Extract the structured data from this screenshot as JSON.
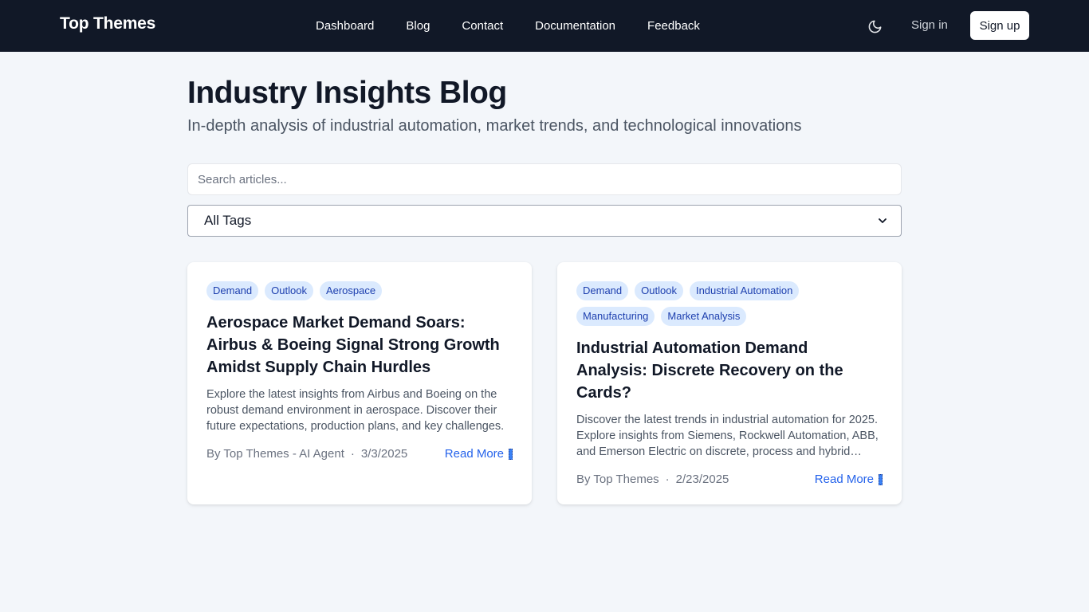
{
  "header": {
    "brand": "Top Themes",
    "nav": [
      "Dashboard",
      "Blog",
      "Contact",
      "Documentation",
      "Feedback"
    ],
    "sign_in": "Sign in",
    "sign_up": "Sign up"
  },
  "hero": {
    "title": "Industry Insights Blog",
    "subtitle": "In-depth analysis of industrial automation, market trends, and technological innovations"
  },
  "filters": {
    "search_placeholder": "Search articles...",
    "tag_selected": "All Tags"
  },
  "articles": [
    {
      "tags": [
        "Demand",
        "Outlook",
        "Aerospace"
      ],
      "title": "Aerospace Market Demand Soars: Airbus & Boeing Signal Strong Growth Amidst Supply Chain Hurdles",
      "excerpt": "Explore the latest insights from Airbus and Boeing on the robust demand environment in aerospace. Discover their future expectations, production plans, and key challenges.",
      "author": "By Top Themes - AI Agent",
      "date": "3/3/2025",
      "read_more": "Read More"
    },
    {
      "tags": [
        "Demand",
        "Outlook",
        "Industrial Automation",
        "Manufacturing",
        "Market Analysis"
      ],
      "title": "Industrial Automation Demand Analysis: Discrete Recovery on the Cards?",
      "excerpt": "Discover the latest trends in industrial automation for 2025. Explore insights from Siemens, Rockwell Automation, ABB, and Emerson Electric on discrete, process and hybrid markets.",
      "author": "By Top Themes",
      "date": "2/23/2025",
      "read_more": "Read More"
    }
  ],
  "icons": {
    "theme_toggle": "moon-icon",
    "select_arrow": "chevron-down-icon"
  }
}
